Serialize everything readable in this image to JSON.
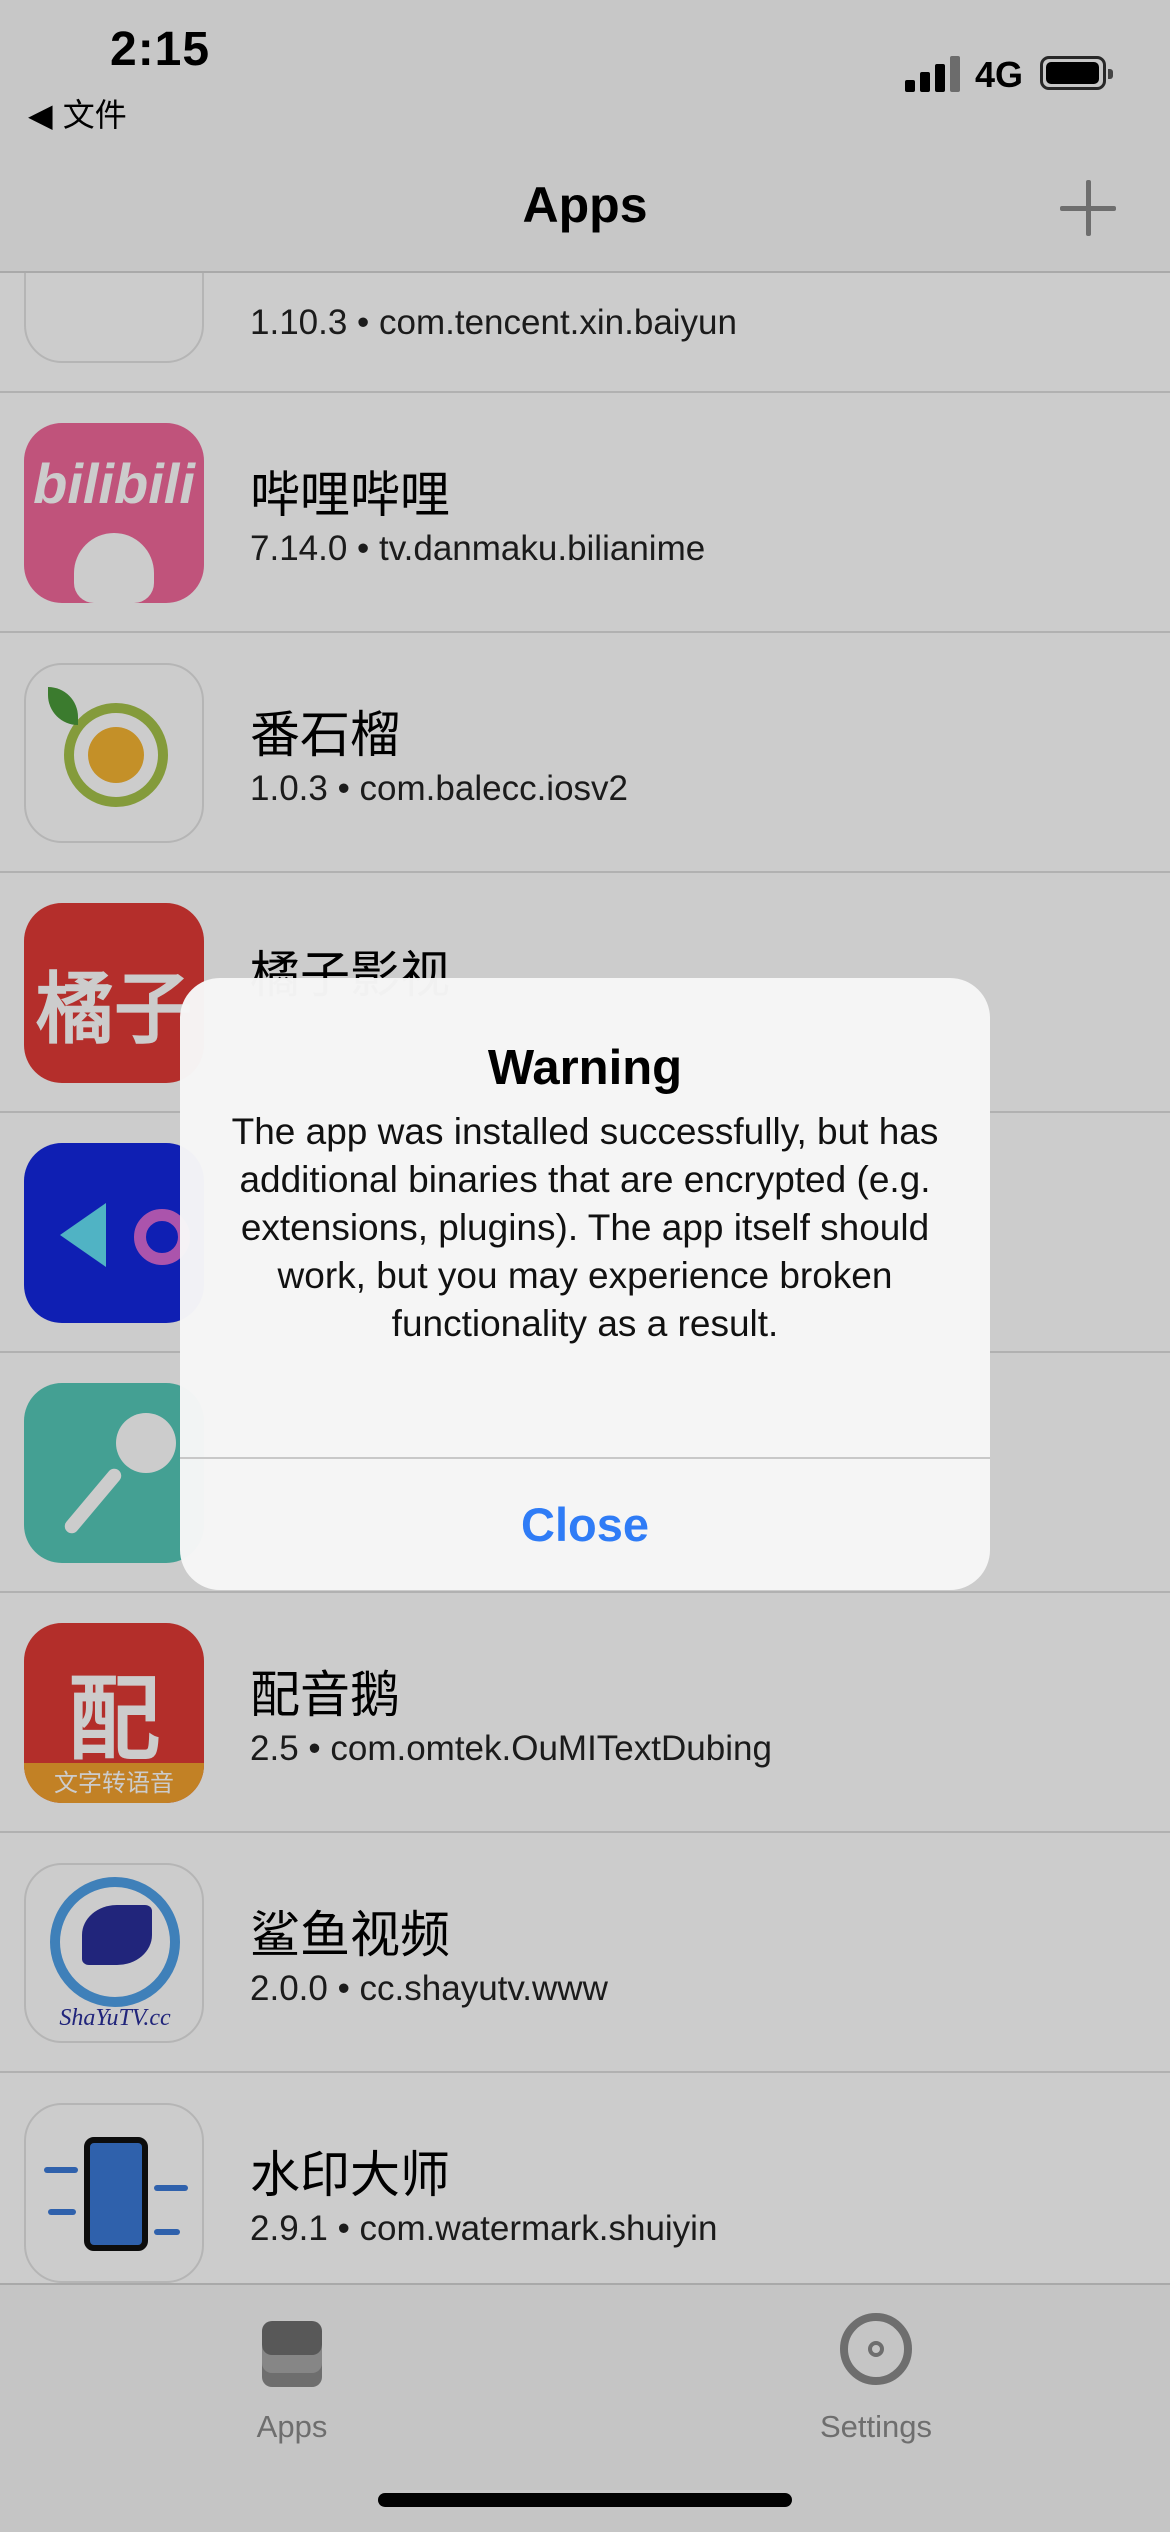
{
  "status_bar": {
    "time": "2:15",
    "back_label": "◀ 文件",
    "network": "4G"
  },
  "nav": {
    "title": "Apps",
    "add_icon": "plus-icon"
  },
  "apps": [
    {
      "name": "",
      "meta": "1.10.3 • com.tencent.xin.baiyun",
      "icon": "partial-app-icon"
    },
    {
      "name": "哔哩哔哩",
      "meta": "7.14.0 • tv.danmaku.bilianime",
      "icon": "bilibili-icon",
      "icon_text": "bilibili"
    },
    {
      "name": "番石榴",
      "meta": "1.0.3 • com.balecc.iosv2",
      "icon": "guava-icon"
    },
    {
      "name": "橘子影视",
      "meta": "",
      "icon": "orange-video-icon",
      "icon_text": "橘子"
    },
    {
      "name": "",
      "meta": "",
      "icon": "blue-play-icon"
    },
    {
      "name": "",
      "meta": "",
      "icon": "microphone-icon"
    },
    {
      "name": "配音鹅",
      "meta": "2.5 • com.omtek.OuMITextDubing",
      "icon": "dubbing-goose-icon",
      "icon_text": "配",
      "icon_band": "文字转语音"
    },
    {
      "name": "鲨鱼视频",
      "meta": "2.0.0 • cc.shayutv.www",
      "icon": "shark-video-icon",
      "icon_text": "ShaYuTV.cc"
    },
    {
      "name": "水印大师",
      "meta": "2.9.1 • com.watermark.shuiyin",
      "icon": "watermark-master-icon"
    }
  ],
  "alert": {
    "title": "Warning",
    "message": "The app was installed successfully, but has additional binaries that are encrypted (e.g. extensions, plugins). The app itself should work, but you may experience broken functionality as a result.",
    "button": "Close"
  },
  "tabs": [
    {
      "label": "Apps",
      "icon": "layers-icon"
    },
    {
      "label": "Settings",
      "icon": "gear-icon"
    }
  ],
  "colors": {
    "accent": "#2f7cf6",
    "tab_inactive": "#8a8a8a"
  }
}
